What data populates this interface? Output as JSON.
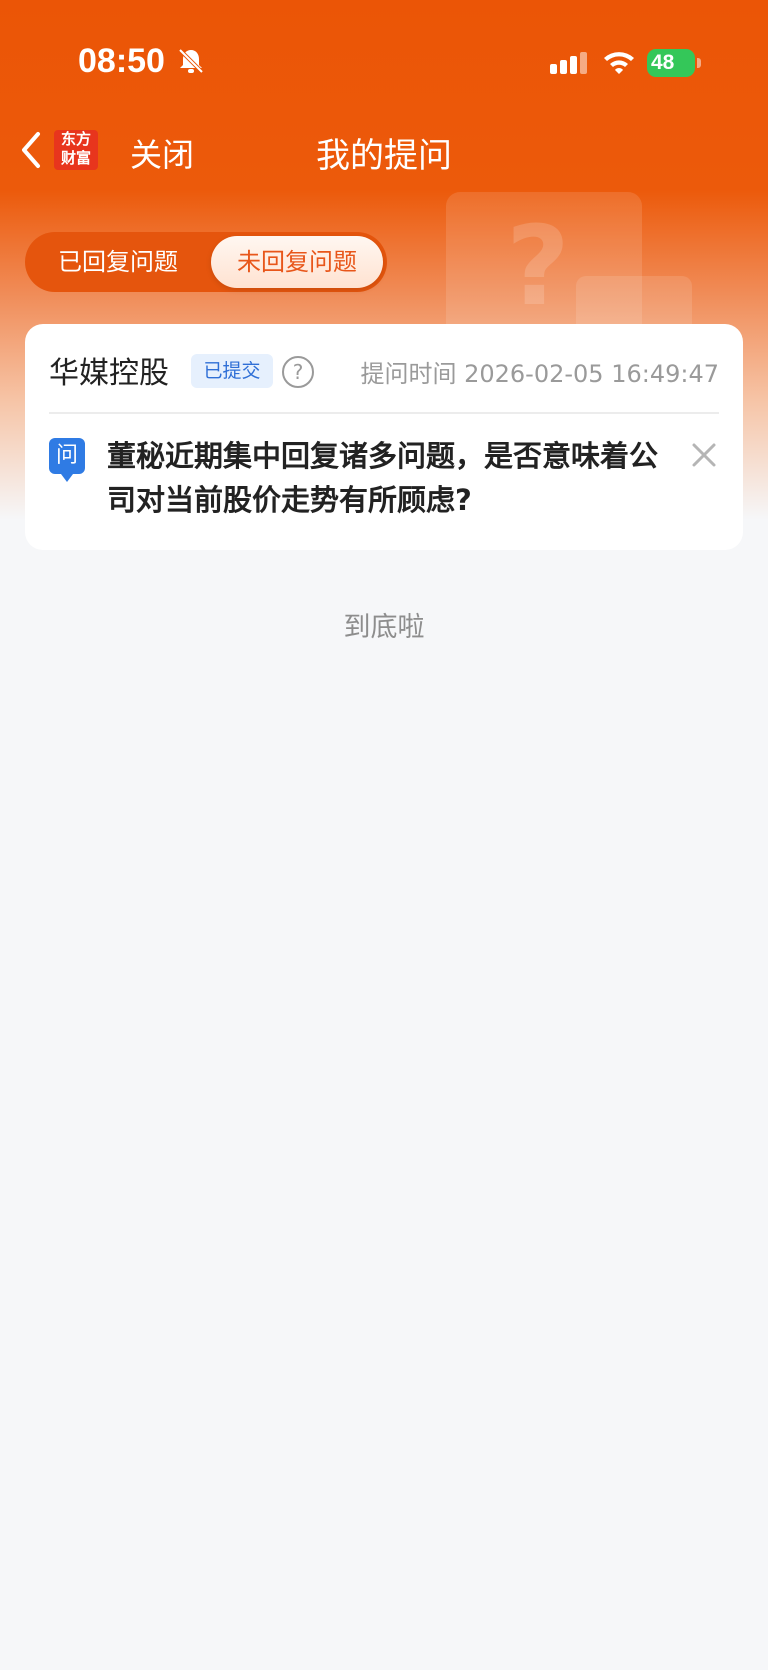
{
  "status_bar": {
    "time": "08:50",
    "battery": "48"
  },
  "nav": {
    "logo_line1": "东方",
    "logo_line2": "财富",
    "close_label": "关闭",
    "title": "我的提问"
  },
  "tabs": [
    {
      "label": "已回复问题",
      "selected": false
    },
    {
      "label": "未回复问题",
      "selected": true
    }
  ],
  "card": {
    "company": "华媒控股",
    "status": "已提交",
    "time": "提问时间 2026-02-05 16:49:47",
    "q_badge": "问",
    "question": "董秘近期集中回复诸多问题，是否意味着公司对当前股价走势有所顾虑?"
  },
  "footer": {
    "end_text": "到底啦"
  },
  "colors": {
    "brand": "#eb5506",
    "badge_blue": "#2f7be4"
  }
}
